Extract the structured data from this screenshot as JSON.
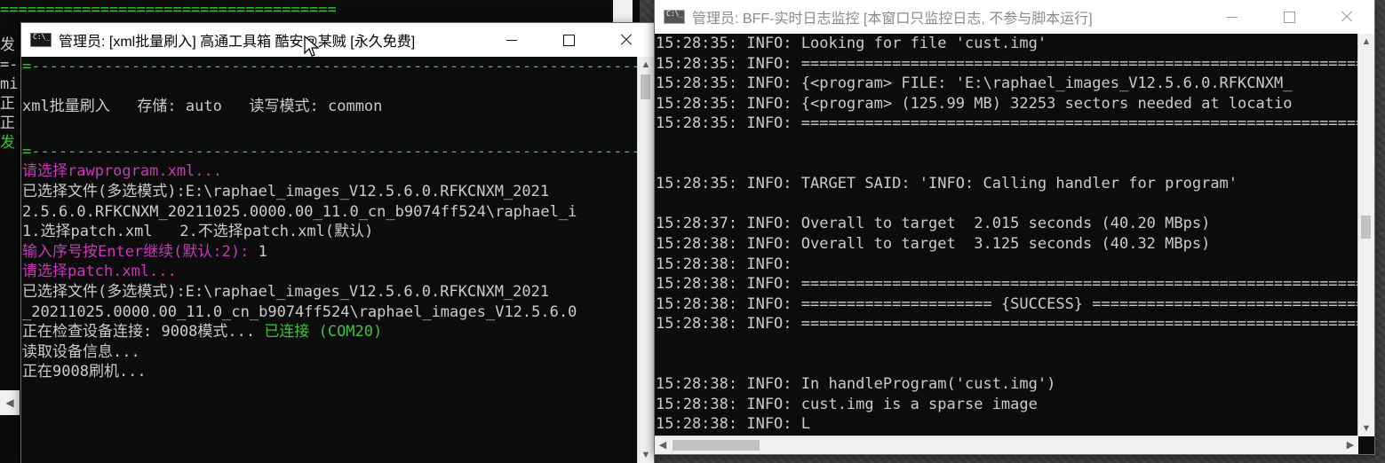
{
  "behind_window": {
    "edge_lines": [
      "=====================================",
      "发",
      "=-",
      "mi",
      "正",
      "正",
      "发"
    ]
  },
  "left_window": {
    "title": "管理员: [xml批量刷入] 高通工具箱 酷安@某贼 [永久免费]",
    "lines": [
      {
        "text": "=--------------------------------------------------------------------=",
        "color": "grn"
      },
      {
        "text": "",
        "color": "grey"
      },
      {
        "text": "xml批量刷入   存储: auto   读写模式: common",
        "color": "grey",
        "size": "tall"
      },
      {
        "text": "",
        "color": "grey"
      },
      {
        "text": "=--------------------------------------------------------------------=",
        "color": "grn"
      },
      {
        "text": "请选择rawprogram.xml...",
        "color": "mag"
      },
      {
        "text": "已选择文件(多选模式):E:\\raphael_images_V12.5.6.0.RFKCNXM_2021",
        "color": "grey"
      },
      {
        "text": "2.5.6.0.RFKCNXM_20211025.0000.00_11.0_cn_b9074ff524\\raphael_i",
        "color": "grey"
      },
      {
        "text": "1.选择patch.xml   2.不选择patch.xml(默认)",
        "color": "grey"
      },
      {
        "segments": [
          {
            "text": "输入序号按Enter继续(默认:2):",
            "color": "mag"
          },
          {
            "text": " 1",
            "color": "grey"
          }
        ]
      },
      {
        "text": "请选择patch.xml...",
        "color": "mag"
      },
      {
        "text": "已选择文件(多选模式):E:\\raphael_images_V12.5.6.0.RFKCNXM_2021",
        "color": "grey"
      },
      {
        "text": "_20211025.0000.00_11.0_cn_b9074ff524\\raphael_images_V12.5.6.0",
        "color": "grey"
      },
      {
        "segments": [
          {
            "text": "正在检查设备连接: 9008模式... ",
            "color": "grey"
          },
          {
            "text": "已连接 (COM20)",
            "color": "grn"
          }
        ]
      },
      {
        "text": "读取设备信息...",
        "color": "grey"
      },
      {
        "text": "正在9008刷机...",
        "color": "grey"
      }
    ]
  },
  "right_window": {
    "title": "管理员: BFF-实时日志监控 [本窗口只监控日志, 不参与脚本运行]",
    "lines": [
      "15:28:35: INFO: Looking for file 'cust.img'",
      "15:28:35: INFO: ==================================================================",
      "15:28:35: INFO: {<program> FILE: 'E:\\raphael_images_V12.5.6.0.RFKCNXM_",
      "15:28:35: INFO: {<program> (125.99 MB) 32253 sectors needed at locatio",
      "15:28:35: INFO: ==================================================================",
      "",
      "",
      "15:28:35: INFO: TARGET SAID: 'INFO: Calling handler for program'",
      "",
      "15:28:37: INFO: Overall to target  2.015 seconds (40.20 MBps)",
      "15:28:38: INFO: Overall to target  3.125 seconds (40.32 MBps)",
      "15:28:38: INFO:",
      "15:28:38: INFO: ==================================================================",
      "15:28:38: INFO: ===================== {SUCCESS} ====================================",
      "15:28:38: INFO: ==================================================================",
      "",
      "",
      "15:28:38: INFO: In handleProgram('cust.img')",
      "15:28:38: INFO: cust.img is a sparse image",
      "15:28:38: INFO: L"
    ]
  },
  "icons": {
    "arrow_up": "▲",
    "arrow_down": "▼",
    "arrow_left": "◀",
    "arrow_right": "▶"
  }
}
